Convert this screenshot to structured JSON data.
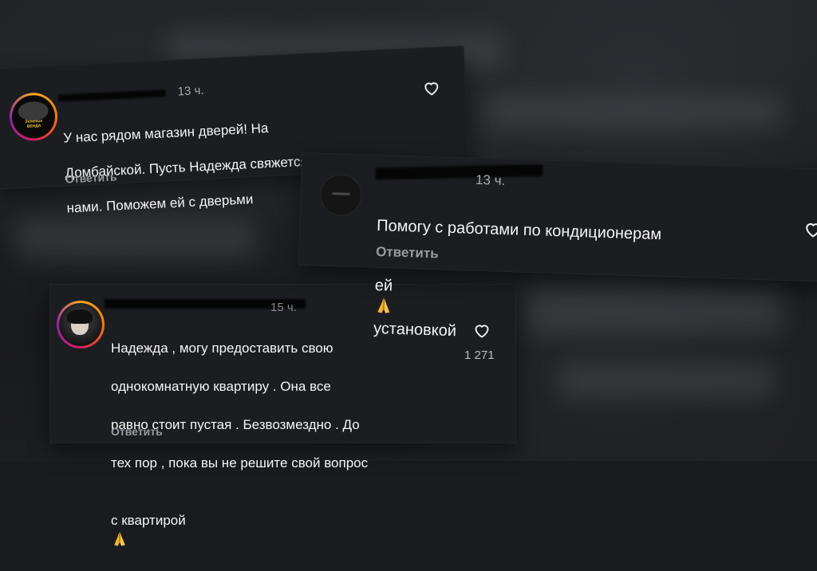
{
  "comments": [
    {
      "time": "13 ч.",
      "avatar_label": "Зеленые ВЕНДА",
      "text_lines": [
        "У нас рядом магазин дверей! На",
        "Домбайской. Пусть Надежда свяжется с",
        "нами. Поможем ей с дверьми"
      ],
      "reply_label": "Ответить",
      "heart_icon": "heart-outline-icon"
    },
    {
      "time": "13 ч.",
      "text_line1": "Помогу с работами по кондиционерам",
      "text_line2a": "ей",
      "text_line2b": "установкой",
      "emoji_icon": "folded-hands-emoji",
      "reply_label": "Ответить",
      "heart_icon": "heart-outline-icon"
    },
    {
      "time": "15 ч.",
      "text_lines": [
        "Надежда , могу предоставить свою",
        "однокомнатную квартиру . Она все",
        "равно стоит пустая . Безвозмездно . До",
        "тех пор , пока вы не решите свой вопрос"
      ],
      "text_last": "с квартирой",
      "emoji_icon": "folded-hands-emoji",
      "likes": "1 271",
      "reply_label": "Ответить",
      "heart_icon": "heart-outline-icon"
    }
  ],
  "colors": {
    "card_bg": "#1c1d21",
    "text": "#f5f5f5",
    "muted": "#9a9ba1",
    "story_ring": "#f57c00",
    "emoji": "#f2b233"
  }
}
